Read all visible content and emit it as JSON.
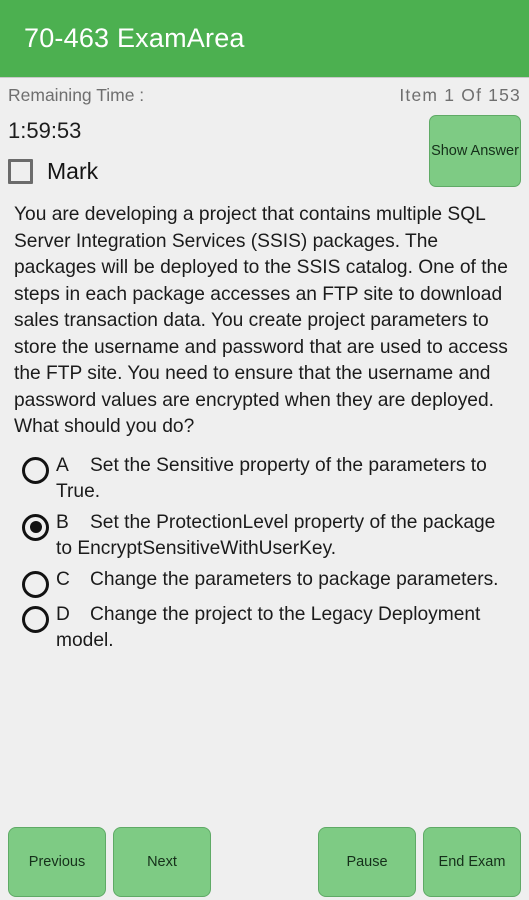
{
  "header": {
    "app_title": "70-463 ExamArea",
    "background_color": "#4cb050",
    "text_color": "#ffffff"
  },
  "status": {
    "remaining_time_label": "Remaining Time :",
    "item_counter": "Item 1 Of 153",
    "current_item": 1,
    "total_items": 153
  },
  "timer": {
    "value": "1:59:53"
  },
  "mark": {
    "label": "Mark",
    "checked": false
  },
  "show_answer": {
    "label": "Show Answer"
  },
  "question": {
    "text": "You are developing a project that contains multiple SQL Server Integration Services (SSIS) packages. The packages will be deployed to the SSIS catalog. One of the steps in each package accesses an FTP site to download sales transaction data. You create project parameters to store the username and password that are used to access the FTP site. You need to ensure that the username and password values are encrypted when they are deployed. What should you do?"
  },
  "options": [
    {
      "letter": "A",
      "text": "Set the Sensitive property of the parameters to True.",
      "selected": false
    },
    {
      "letter": "B",
      "text": "Set the ProtectionLevel property of the package to EncryptSensitiveWithUserKey.",
      "selected": true
    },
    {
      "letter": "C",
      "text": "Change the parameters to package parameters.",
      "selected": false
    },
    {
      "letter": "D",
      "text": "Change the project to the Legacy Deployment model.",
      "selected": false
    }
  ],
  "buttons": {
    "previous": "Previous",
    "next": "Next",
    "pause": "Pause",
    "end_exam": "End Exam",
    "background_color": "#7ecb84"
  }
}
